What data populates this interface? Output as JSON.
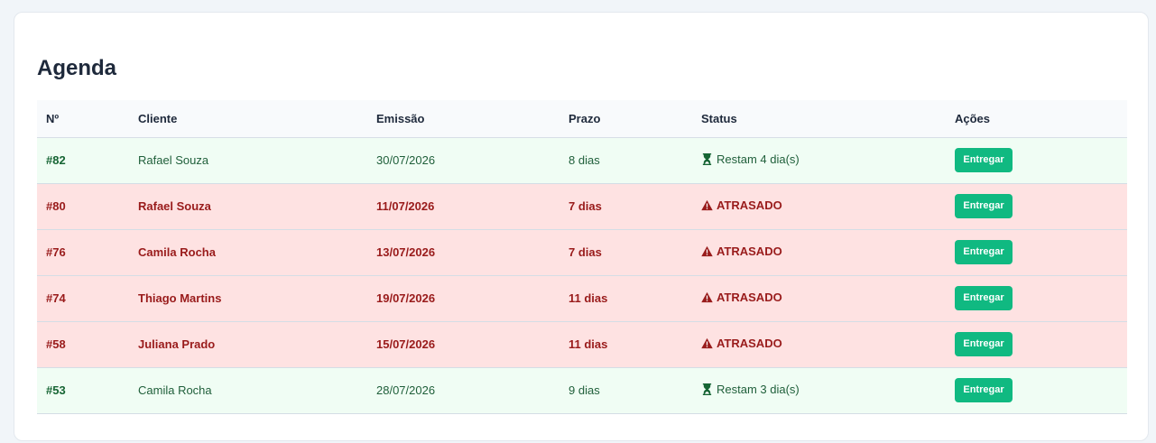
{
  "page": {
    "title": "Agenda"
  },
  "table": {
    "headers": [
      "Nº",
      "Cliente",
      "Emissão",
      "Prazo",
      "Status",
      "Ações"
    ],
    "rows": [
      {
        "num": "#82",
        "cliente": "Rafael Souza",
        "emissao": "30/07/2026",
        "prazo": "8 dias",
        "status": "Restam 4 dia(s)",
        "status_icon": "hourglass-icon",
        "state": "ok",
        "action": "Entregar"
      },
      {
        "num": "#80",
        "cliente": "Rafael Souza",
        "emissao": "11/07/2026",
        "prazo": "7 dias",
        "status": "ATRASADO",
        "status_icon": "warning-icon",
        "state": "late",
        "action": "Entregar"
      },
      {
        "num": "#76",
        "cliente": "Camila Rocha",
        "emissao": "13/07/2026",
        "prazo": "7 dias",
        "status": "ATRASADO",
        "status_icon": "warning-icon",
        "state": "late",
        "action": "Entregar"
      },
      {
        "num": "#74",
        "cliente": "Thiago Martins",
        "emissao": "19/07/2026",
        "prazo": "11 dias",
        "status": "ATRASADO",
        "status_icon": "warning-icon",
        "state": "late",
        "action": "Entregar"
      },
      {
        "num": "#58",
        "cliente": "Juliana Prado",
        "emissao": "15/07/2026",
        "prazo": "11 dias",
        "status": "ATRASADO",
        "status_icon": "warning-icon",
        "state": "late",
        "action": "Entregar"
      },
      {
        "num": "#53",
        "cliente": "Camila Rocha",
        "emissao": "28/07/2026",
        "prazo": "9 dias",
        "status": "Restam 3 dia(s)",
        "status_icon": "hourglass-icon",
        "state": "ok",
        "action": "Entregar"
      }
    ]
  },
  "colors": {
    "ok_row_bg": "#f0fdf4",
    "late_row_bg": "#fee2e2",
    "late_text": "#991b1b",
    "ok_text": "#166534",
    "button_bg": "#10b981"
  }
}
